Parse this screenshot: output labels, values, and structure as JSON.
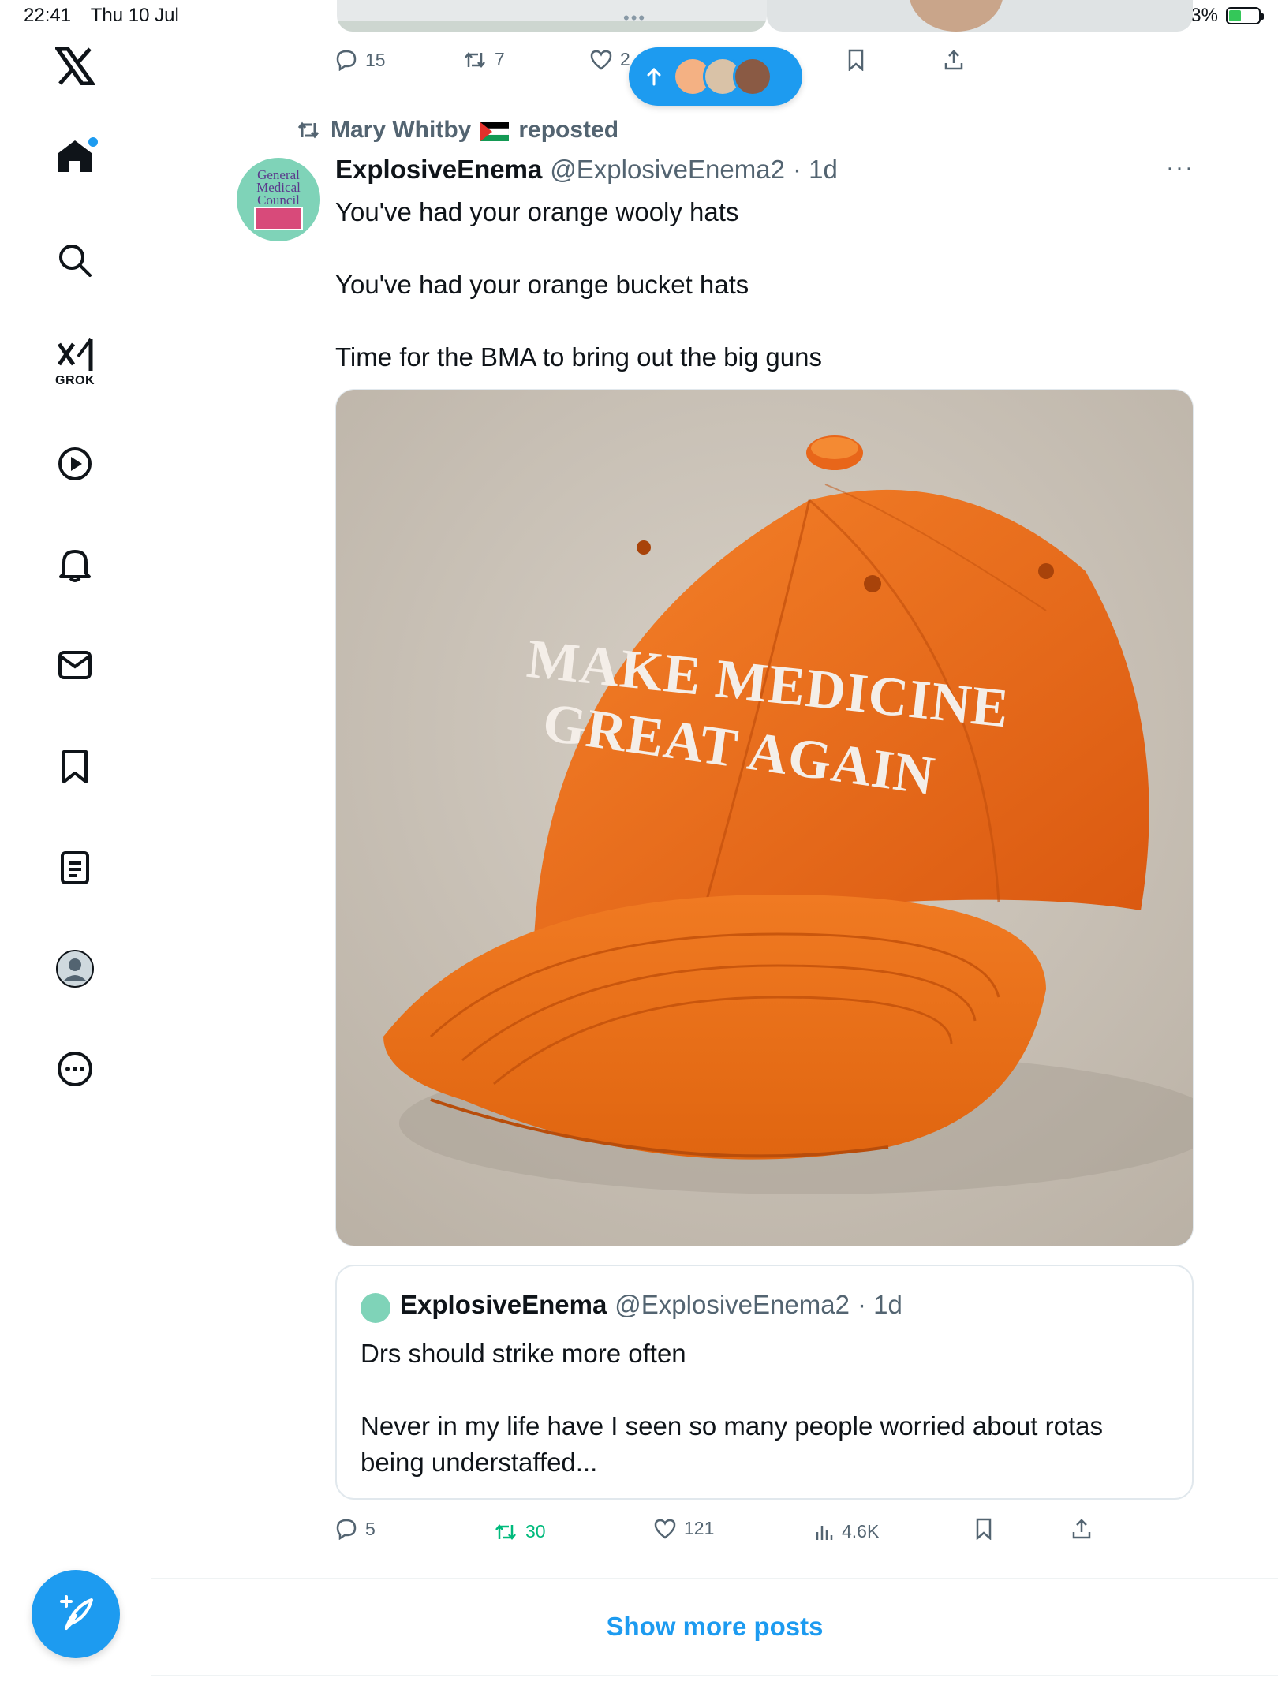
{
  "status_bar": {
    "time": "22:41",
    "date": "Thu 10 Jul",
    "battery": "43%",
    "battery_level": 0.43
  },
  "sidebar": {
    "grok_label": "GROK",
    "icons": [
      "x-logo-icon",
      "home-icon",
      "search-icon",
      "grok-icon",
      "video-icon",
      "bell-icon",
      "mail-icon",
      "bookmark-icon",
      "lists-icon",
      "profile-icon",
      "more-icon"
    ],
    "compose_icon": "compose-icon"
  },
  "previous_tweet": {
    "replies": "15",
    "reposts": "7",
    "likes": "2"
  },
  "new_posts_pill": {
    "icon": "arrow-up-icon"
  },
  "tweet": {
    "reposted_by": "Mary Whitby",
    "reposted_suffix": "reposted",
    "author_name": "ExplosiveEnema",
    "author_handle": "@ExplosiveEnema2",
    "time": "· 1d",
    "avatar_text": [
      "General",
      "Medical",
      "Council"
    ],
    "lines": [
      "You've had your orange wooly hats",
      "",
      "You've had your orange bucket hats",
      "",
      "Time for the BMA to bring out the big guns"
    ],
    "image": {
      "cap_text_line1": "MAKE MEDICINE",
      "cap_text_line2": "GREAT AGAIN"
    },
    "quote": {
      "author_name": "ExplosiveEnema",
      "author_handle": "@ExplosiveEnema2",
      "time": "· 1d",
      "line1": "Drs should strike more often",
      "line2": "Never in my life have I seen so many people worried about rotas",
      "line3": "being understaffed..."
    },
    "stats": {
      "replies": "5",
      "reposts": "30",
      "likes": "121",
      "views": "4.6K"
    }
  },
  "show_more": "Show more posts",
  "colors": {
    "accent": "#1d9bf0",
    "repost_active": "#00ba7c",
    "secondary_text": "#536471",
    "cap_orange": "#f0731f"
  }
}
